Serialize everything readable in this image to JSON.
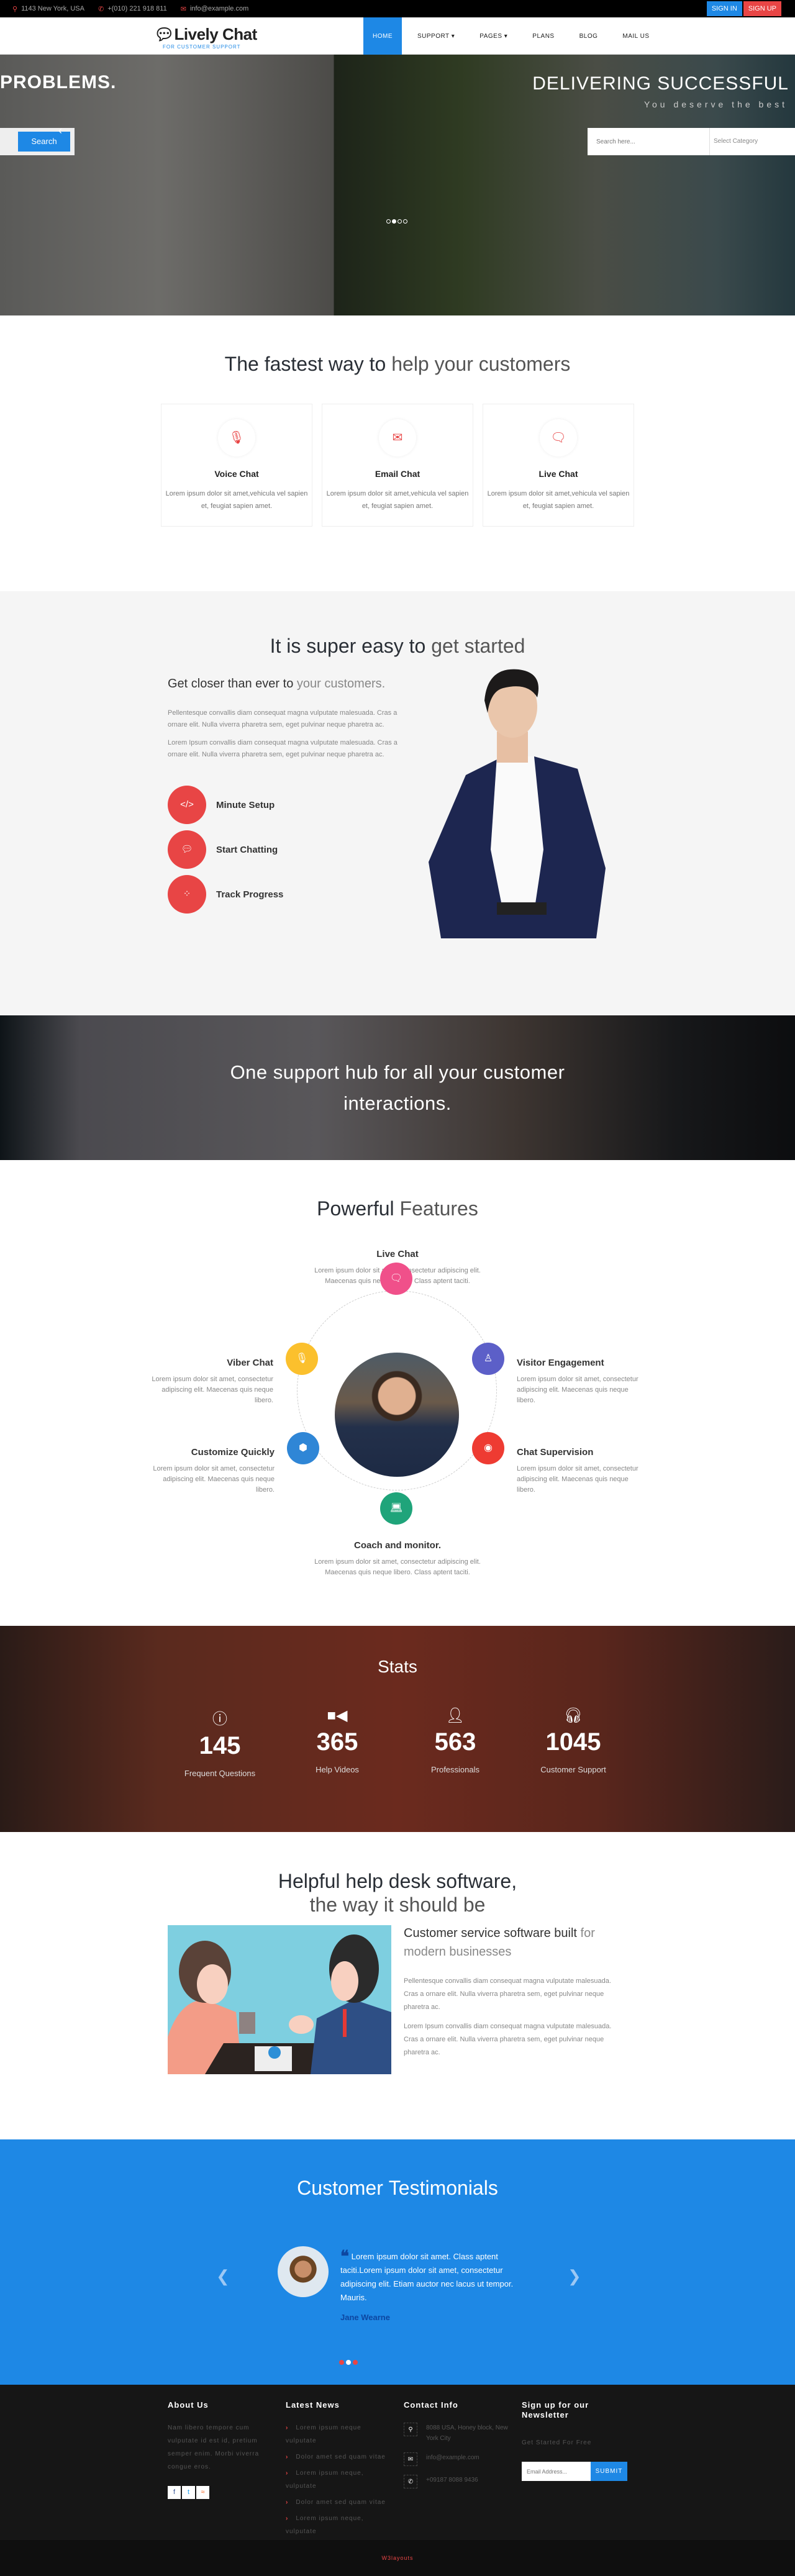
{
  "topbar": {
    "address": "1143 New York, USA",
    "phone": "+(010) 221 918 811",
    "email": "info@example.com",
    "sign_in": "SIGN IN",
    "sign_up": "SIGN UP"
  },
  "nav": {
    "logo": "Lively Chat",
    "tagline": "FOR CUSTOMER SUPPORT",
    "items": [
      "HOME",
      "SUPPORT ▾",
      "PAGES ▾",
      "PLANS",
      "BLOG",
      "MAIL US"
    ]
  },
  "hero": {
    "left_heading": "PROBLEMS.",
    "search_button": "Search",
    "right_heading": "DELIVERING SUCCESSFUL",
    "subtitle": "You deserve the best",
    "search_placeholder": "Search here...",
    "category": "Select Category"
  },
  "fastest": {
    "title_bold": "The fastest way to",
    "title_light": "help your customers",
    "cards": [
      {
        "title": "Voice Chat",
        "text": "Lorem ipsum dolor sit amet,vehicula vel sapien et, feugiat sapien amet."
      },
      {
        "title": "Email Chat",
        "text": "Lorem ipsum dolor sit amet,vehicula vel sapien et, feugiat sapien amet."
      },
      {
        "title": "Live Chat",
        "text": "Lorem ipsum dolor sit amet,vehicula vel sapien et, feugiat sapien amet."
      }
    ]
  },
  "easy": {
    "title_bold": "It is super easy to",
    "title_light": "get started",
    "subtitle_bold": "Get closer than ever to",
    "subtitle_light": "your customers.",
    "p1": "Pellentesque convallis diam consequat magna vulputate malesuada. Cras a ornare elit. Nulla viverra pharetra sem, eget pulvinar neque pharetra ac.",
    "p2": "Lorem Ipsum convallis diam consequat magna vulputate malesuada. Cras a ornare elit. Nulla viverra pharetra sem, eget pulvinar neque pharetra ac.",
    "steps": [
      "Minute Setup",
      "Start Chatting",
      "Track Progress"
    ]
  },
  "banner": {
    "text": "One support hub for all your customer interactions."
  },
  "features": {
    "title_bold": "Powerful",
    "title_light": "Features",
    "items": [
      {
        "title": "Live Chat",
        "text": "Lorem ipsum dolor sit amet, consectetur adipiscing elit. Maecenas quis neque libero. Class aptent taciti.",
        "color": "#f0508a"
      },
      {
        "title": "Viber Chat",
        "text": "Lorem ipsum dolor sit amet, consectetur adipiscing elit. Maecenas quis neque libero.",
        "color": "#fbc02d"
      },
      {
        "title": "Visitor Engagement",
        "text": "Lorem ipsum dolor sit amet, consectetur adipiscing elit. Maecenas quis neque libero.",
        "color": "#5c5fc8"
      },
      {
        "title": "Customize Quickly",
        "text": "Lorem ipsum dolor sit amet, consectetur adipiscing elit. Maecenas quis neque libero.",
        "color": "#2f86d6"
      },
      {
        "title": "Chat Supervision",
        "text": "Lorem ipsum dolor sit amet, consectetur adipiscing elit. Maecenas quis neque libero.",
        "color": "#ee3b32"
      },
      {
        "title": "Coach and monitor.",
        "text": "Lorem ipsum dolor sit amet, consectetur adipiscing elit. Maecenas quis neque libero. Class aptent taciti.",
        "color": "#1fa47a"
      }
    ]
  },
  "stats": {
    "title": "Stats",
    "items": [
      {
        "value": "145",
        "label": "Frequent Questions",
        "icon": "question-icon"
      },
      {
        "value": "365",
        "label": "Help Videos",
        "icon": "video-icon"
      },
      {
        "value": "563",
        "label": "Professionals",
        "icon": "user-icon"
      },
      {
        "value": "1045",
        "label": "Customer Support",
        "icon": "headphones-icon"
      }
    ]
  },
  "helpful": {
    "title_bold": "Helpful help desk software,",
    "title_light": "the way it should be",
    "sub_bold": "Customer service software built",
    "sub_light": "for modern businesses",
    "p1": "Pellentesque convallis diam consequat magna vulputate malesuada. Cras a ornare elit. Nulla viverra pharetra sem, eget pulvinar neque pharetra ac.",
    "p2": "Lorem Ipsum convallis diam consequat magna vulputate malesuada. Cras a ornare elit. Nulla viverra pharetra sem, eget pulvinar neque pharetra ac."
  },
  "testimonials": {
    "title_bold": "Customer",
    "title_light": "Testimonials",
    "quote": "Lorem ipsum dolor sit amet. Class aptent taciti.Lorem ipsum dolor sit amet, consectetur adipiscing elit. Etiam auctor nec lacus ut tempor. Mauris.",
    "name": "Jane Wearne"
  },
  "footer": {
    "about_title": "About Us",
    "about_text": "Nam libero tempore cum vulputate id est id, pretium semper enim. Morbi viverra congue eros.",
    "news_title": "Latest News",
    "news": [
      "Lorem ipsum neque vulputate",
      "Dolor amet sed quam vitae",
      "Lorem ipsum neque, vulputate",
      "Dolor amet sed quam vitae",
      "Lorem ipsum neque, vulputate"
    ],
    "contact_title": "Contact Info",
    "address": "8088 USA, Honey block, New York City",
    "email": "info@example.com",
    "phone": "+09187 8088 9436",
    "newsletter_title": "Sign up for our Newsletter",
    "newsletter_text": "Get Started For Free",
    "email_placeholder": "Email Address...",
    "submit": "SUBMIT",
    "copyright": "W3layouts"
  },
  "colors": {
    "accent": "#1e88e5",
    "red": "#e84545"
  }
}
